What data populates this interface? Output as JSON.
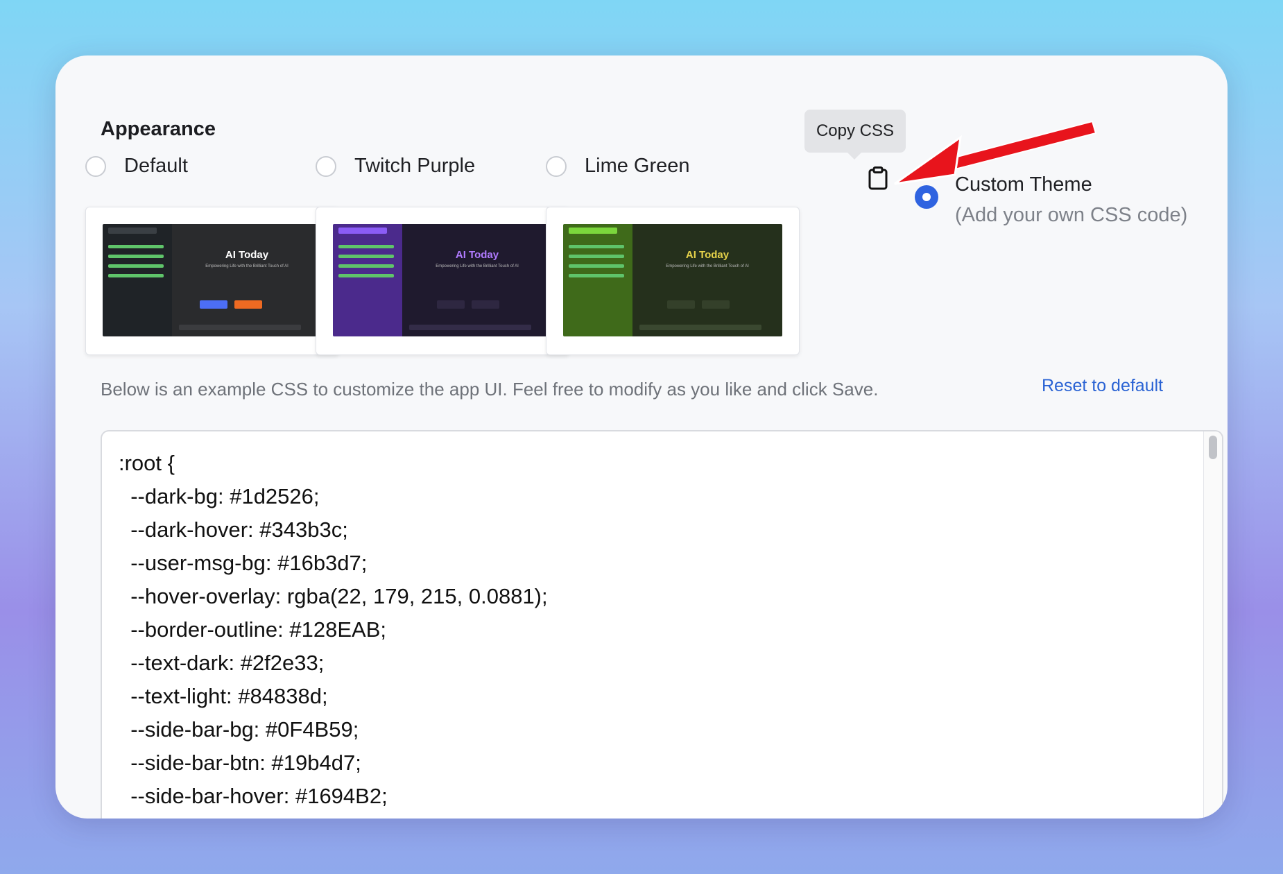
{
  "section": {
    "title": "Appearance"
  },
  "themes": [
    {
      "label": "Default",
      "selected": false,
      "preview": {
        "app_title": "AI Today",
        "subtitle": "Empowering Life with the Brilliant Touch of AI",
        "side": "#1f2327",
        "main": "#2a2b2d",
        "accent": "#4c6ef5",
        "title_color": "#ffffff"
      }
    },
    {
      "label": "Twitch Purple",
      "selected": false,
      "preview": {
        "app_title": "AI Today",
        "subtitle": "Empowering Life with the Brilliant Touch of AI",
        "side": "#4b2a8c",
        "main": "#1f1a2e",
        "accent": "#8b5cf6",
        "title_color": "#b07bff"
      }
    },
    {
      "label": "Lime Green",
      "selected": false,
      "preview": {
        "app_title": "AI Today",
        "subtitle": "Empowering Life with the Brilliant Touch of AI",
        "side": "#3f6a1a",
        "main": "#25301c",
        "accent": "#7bd63c",
        "title_color": "#e6d24a"
      }
    }
  ],
  "copy_css": {
    "tooltip": "Copy CSS",
    "icon": "clipboard-icon"
  },
  "custom_theme": {
    "label": "Custom Theme",
    "sublabel": "(Add your own CSS code)",
    "selected": true
  },
  "description": "Below is an example CSS to customize the app UI. Feel free to modify as you like and click Save.",
  "reset_label": "Reset to default",
  "css_code": ":root {\n  --dark-bg: #1d2526;\n  --dark-hover: #343b3c;\n  --user-msg-bg: #16b3d7;\n  --hover-overlay: rgba(22, 179, 215, 0.0881);\n  --border-outline: #128EAB;\n  --text-dark: #2f2e33;\n  --text-light: #84838d;\n  --side-bar-bg: #0F4B59;\n  --side-bar-btn: #19b4d7;\n  --side-bar-hover: #1694B2;",
  "colors": {
    "accent": "#2f63e0",
    "link": "#2a63d4",
    "arrow": "#e8141c"
  }
}
